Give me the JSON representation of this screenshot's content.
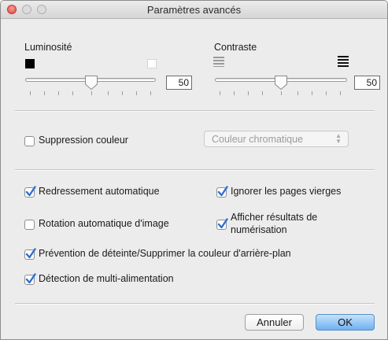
{
  "window": {
    "title": "Paramètres avancés"
  },
  "brightness": {
    "label": "Luminosité",
    "value": "50",
    "level": 0.5
  },
  "contrast": {
    "label": "Contraste",
    "value": "50",
    "level": 0.5
  },
  "color_drop": {
    "label": "Suppression couleur",
    "checked": false,
    "popup_value": "Couleur chromatique",
    "popup_enabled": false
  },
  "options": {
    "deskew": {
      "label": "Redressement automatique",
      "checked": true
    },
    "skip_blank": {
      "label": "Ignorer les pages vierges",
      "checked": true
    },
    "auto_rotate": {
      "label": "Rotation automatique d'image",
      "checked": false
    },
    "show_results": {
      "label_line1": "Afficher résultats de",
      "label_line2": "numérisation",
      "checked": true
    },
    "bleed_through": {
      "label": "Prévention de déteinte/Supprimer la couleur d'arrière-plan",
      "checked": true
    },
    "multifeed": {
      "label": "Détection de multi-alimentation",
      "checked": true
    }
  },
  "buttons": {
    "cancel": "Annuler",
    "ok": "OK"
  },
  "colors": {
    "accent": "#2f6fcf",
    "window_bg": "#ececec",
    "close_light": "#e2463d"
  }
}
